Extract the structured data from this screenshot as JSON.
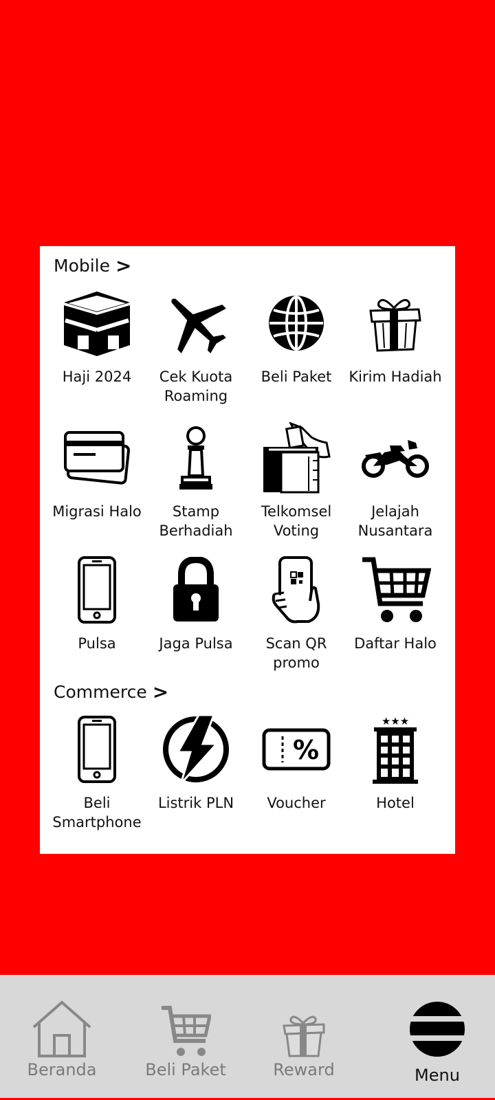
{
  "sections": {
    "mobile": {
      "title": "Mobile",
      "chevron": ">"
    },
    "commerce": {
      "title": "Commerce",
      "chevron": ">"
    }
  },
  "mobile_items": [
    {
      "label": "Haji 2024",
      "icon": "kaaba-icon"
    },
    {
      "label": "Cek Kuota\nRoaming",
      "icon": "airplane-icon"
    },
    {
      "label": "Beli Paket",
      "icon": "globe-icon"
    },
    {
      "label": "Kirim Hadiah",
      "icon": "gift-icon"
    },
    {
      "label": "Migrasi Halo",
      "icon": "credit-card-icon"
    },
    {
      "label": "Stamp\nBerhadiah",
      "icon": "chess-pawn-icon"
    },
    {
      "label": "Telkomsel\nVoting",
      "icon": "ballot-box-icon"
    },
    {
      "label": "Jelajah\nNusantara",
      "icon": "motorcycle-icon"
    },
    {
      "label": "Pulsa",
      "icon": "smartphone-icon"
    },
    {
      "label": "Jaga Pulsa",
      "icon": "padlock-icon"
    },
    {
      "label": "Scan QR\npromo",
      "icon": "qr-phone-icon"
    },
    {
      "label": "Daftar Halo",
      "icon": "shopping-cart-icon"
    }
  ],
  "commerce_items": [
    {
      "label": "Beli\nSmartphone",
      "icon": "smartphone-icon"
    },
    {
      "label": "Listrik PLN",
      "icon": "lightning-icon"
    },
    {
      "label": "Voucher",
      "icon": "voucher-icon"
    },
    {
      "label": "Hotel",
      "icon": "hotel-icon"
    }
  ],
  "nav": [
    {
      "label": "Beranda",
      "icon": "home-icon"
    },
    {
      "label": "Beli Paket",
      "icon": "cart-icon"
    },
    {
      "label": "Reward",
      "icon": "gift-icon"
    },
    {
      "label": "Menu",
      "icon": "menu-icon"
    }
  ],
  "colors": {
    "background": "#ff0000",
    "panel": "#ffffff",
    "navbar": "#d8d8d8",
    "inactive": "#7a7a7a"
  }
}
